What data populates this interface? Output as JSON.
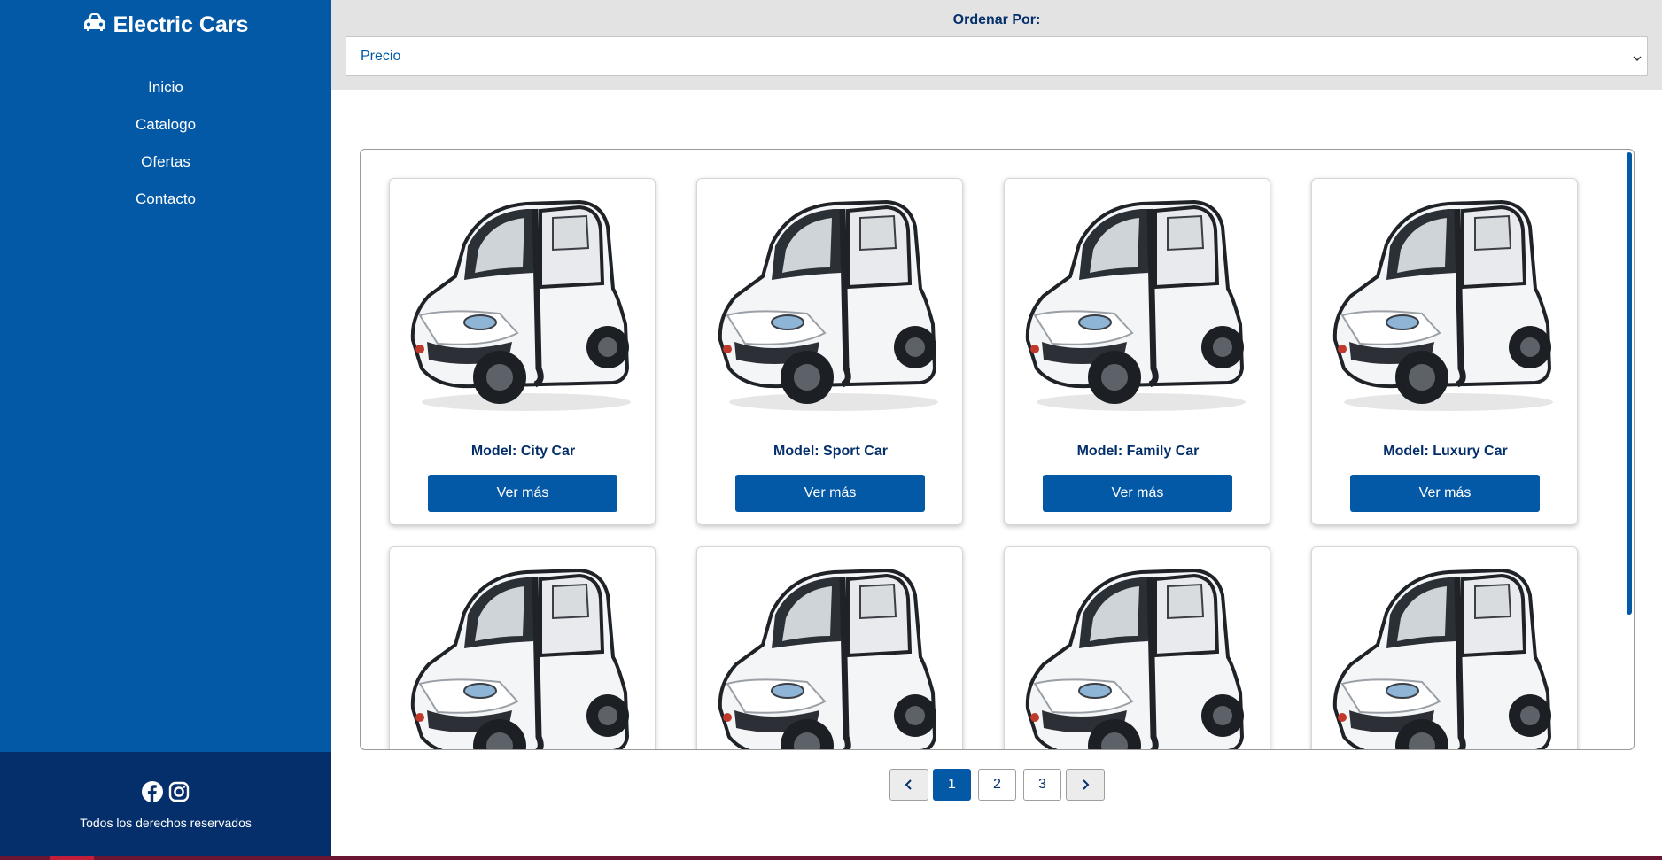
{
  "brand": {
    "name": "Electric Cars",
    "icon": "car-icon"
  },
  "nav": {
    "items": [
      {
        "label": "Inicio"
      },
      {
        "label": "Catalogo"
      },
      {
        "label": "Ofertas"
      },
      {
        "label": "Contacto"
      }
    ]
  },
  "footer": {
    "social": [
      "facebook-icon",
      "instagram-icon"
    ],
    "copyright": "Todos los derechos reservados"
  },
  "sort": {
    "label": "Ordenar Por:",
    "selected": "Precio"
  },
  "catalog": {
    "cards": [
      {
        "model": "Model: City Car",
        "button": "Ver más"
      },
      {
        "model": "Model: Sport Car",
        "button": "Ver más"
      },
      {
        "model": "Model: Family Car",
        "button": "Ver más"
      },
      {
        "model": "Model: Luxury Car",
        "button": "Ver más"
      },
      {
        "model": "",
        "button": ""
      },
      {
        "model": "",
        "button": ""
      },
      {
        "model": "",
        "button": ""
      },
      {
        "model": "",
        "button": ""
      }
    ]
  },
  "pagination": {
    "pages": [
      "1",
      "2",
      "3"
    ],
    "current": "1"
  },
  "colors": {
    "sidebar": "#0459a6",
    "sidebar_footer": "#042f6b",
    "accent": "#0459a6",
    "text_dark": "#042f6b"
  }
}
